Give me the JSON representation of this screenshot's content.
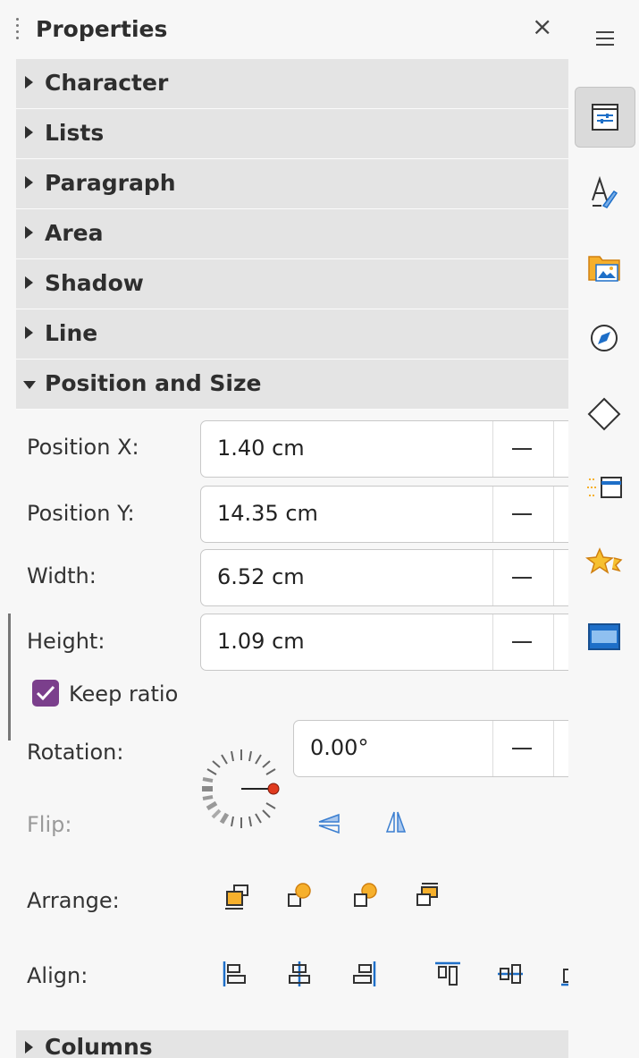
{
  "panel": {
    "title": "Properties",
    "close_icon": "close-icon"
  },
  "sections": {
    "character": "Character",
    "lists": "Lists",
    "paragraph": "Paragraph",
    "area": "Area",
    "shadow": "Shadow",
    "line": "Line",
    "position_size": "Position and Size",
    "columns": "Columns"
  },
  "position_size": {
    "position_x_label": "Position X:",
    "position_x_value": "1.40 cm",
    "position_y_label": "Position Y:",
    "position_y_value": "14.35 cm",
    "width_label": "Width:",
    "width_value": "6.52 cm",
    "height_label": "Height:",
    "height_value": "1.09 cm",
    "keep_ratio_label": "Keep ratio",
    "keep_ratio_checked": true,
    "rotation_label": "Rotation:",
    "rotation_value": "0.00°",
    "flip_label": "Flip:",
    "arrange_label": "Arrange:",
    "align_label": "Align:"
  },
  "colors": {
    "accent": "#7b3f8c",
    "icon_blue": "#1e6fc8",
    "icon_orange": "#f0a020",
    "dial_red": "#e03a1e"
  },
  "sidebar": {
    "icons": [
      "menu-icon",
      "properties-icon",
      "styles-icon",
      "gallery-icon",
      "navigator-icon",
      "shapes-icon",
      "animation-icon",
      "star-effects-icon",
      "slide-transition-icon"
    ]
  }
}
